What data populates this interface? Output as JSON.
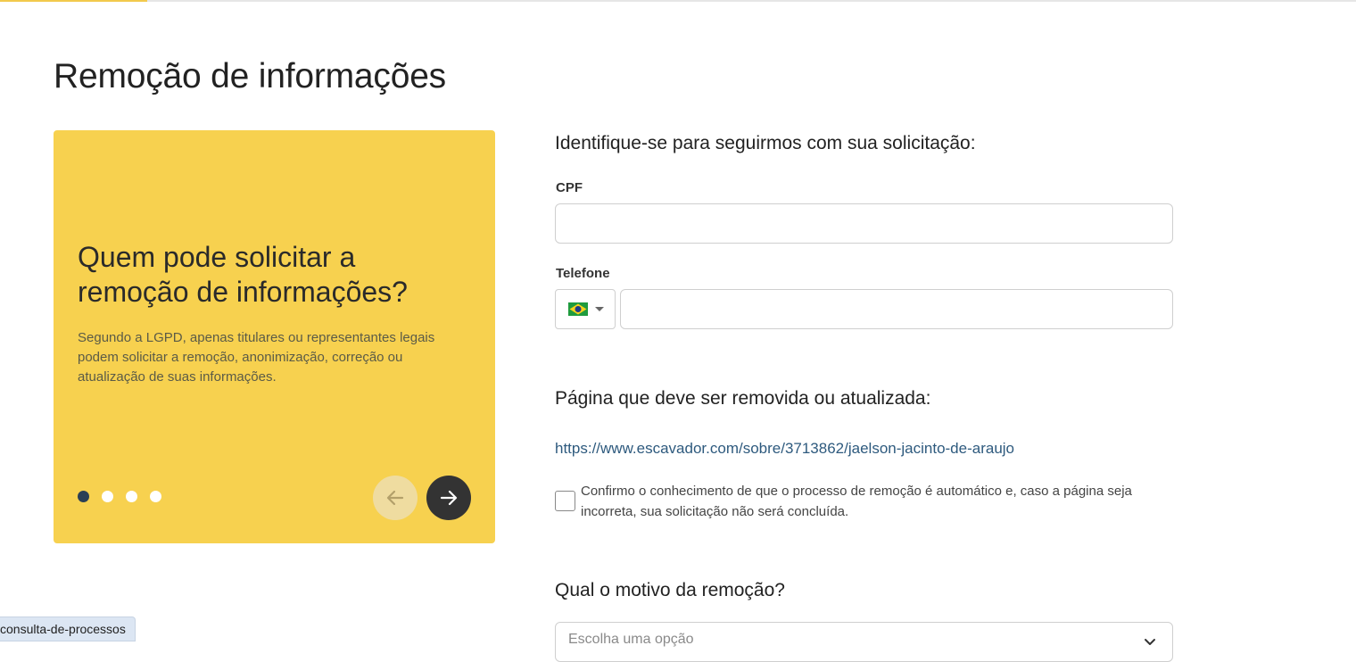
{
  "page": {
    "title": "Remoção de informações"
  },
  "carousel": {
    "heading": "Quem pode solicitar a remoção de informações?",
    "text": "Segundo a LGPD, apenas titulares ou representantes legais podem solicitar a remoção, anonimização, correção ou atualização de suas informações.",
    "slide_count": 4,
    "active_slide": 1,
    "prev_icon": "arrow-left-icon",
    "next_icon": "arrow-right-icon",
    "background_color": "#f7d14f"
  },
  "form": {
    "identify_title": "Identifique-se para seguirmos com sua solicitação:",
    "cpf_label": "CPF",
    "cpf_value": "",
    "phone_label": "Telefone",
    "phone_country": "brazil-flag-icon",
    "phone_value": "",
    "page_title": "Página que deve ser removida ou atualizada:",
    "page_url": "https://www.escavador.com/sobre/3713862/jaelson-jacinto-de-araujo",
    "confirm_text": "Confirmo o conhecimento de que o processo de remoção é automático e, caso a página seja incorreta, sua solicitação não será concluída.",
    "confirm_checked": false,
    "reason_title": "Qual o motivo da remoção?",
    "reason_placeholder": "Escolha uma opção"
  },
  "status_bar": {
    "link": "consulta-de-processos"
  },
  "colors": {
    "link": "#2e5a7e",
    "dark_button": "#333333",
    "active_dot": "#2b3f55"
  }
}
